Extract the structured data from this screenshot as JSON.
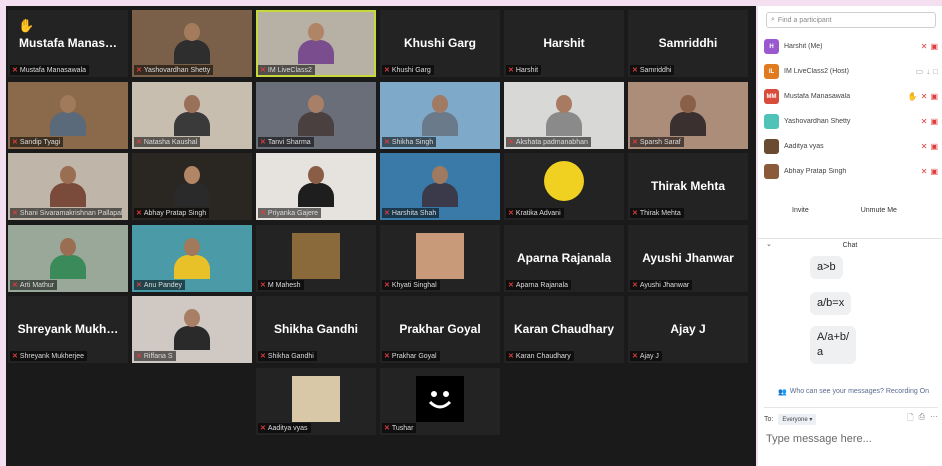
{
  "tiles": [
    {
      "name": "Mustafa  Manas…",
      "label": "Mustafa Manasawala",
      "video": false,
      "hand": true,
      "big": true
    },
    {
      "label": "Yashovardhan Shetty",
      "video": true,
      "bg": "#7a6048",
      "skin": "#a57b5e",
      "shirt": "#2e2e2e"
    },
    {
      "label": "IM LiveClass2",
      "video": true,
      "active": true,
      "bg": "#b7b0a4",
      "skin": "#b08466",
      "shirt": "#7a4d8e"
    },
    {
      "name": "Khushi Garg",
      "label": "Khushi Garg",
      "video": false,
      "big": true
    },
    {
      "name": "Harshit",
      "label": "Harshit",
      "video": false,
      "big": true
    },
    {
      "name": "Samriddhi",
      "label": "Samriddhi",
      "video": false,
      "big": true
    },
    {
      "label": "Sandip Tyagi",
      "video": true,
      "bg": "#8a6a4a",
      "skin": "#a07a5a",
      "shirt": "#5a6a7a"
    },
    {
      "label": "Natasha Kaushal",
      "video": true,
      "bg": "#c8beb0",
      "skin": "#9a7058",
      "shirt": "#3a3a3a"
    },
    {
      "label": "Tanvi Sharma",
      "video": true,
      "bg": "#6a6e78",
      "skin": "#a88068",
      "shirt": "#4a4040"
    },
    {
      "label": "Shikha Singh",
      "video": true,
      "bg": "#7ea9c8",
      "skin": "#a07a62",
      "shirt": "#6a7a8a"
    },
    {
      "label": "Akshata padmanabhan",
      "video": true,
      "bg": "#d8d8d6",
      "skin": "#a87a62",
      "shirt": "#8a8a8a"
    },
    {
      "label": "Sparsh Saraf",
      "video": true,
      "bg": "#ab8d7a",
      "skin": "#8a6048",
      "shirt": "#3a3030"
    },
    {
      "label": "Shani Sivaramakrishnan Pallapalli",
      "video": true,
      "bg": "#bfb5a8",
      "skin": "#9a6e52",
      "shirt": "#7a4a3a"
    },
    {
      "label": "Abhay Pratap Singh",
      "video": true,
      "bg": "#2a2622",
      "skin": "#b08666",
      "shirt": "#2a2a2a"
    },
    {
      "label": "Priyanka Gajere",
      "video": true,
      "bg": "#e6e3de",
      "skin": "#8a5e46",
      "shirt": "#1e1e1e"
    },
    {
      "label": "Harshita Shah",
      "video": true,
      "bg": "#3a7aa8",
      "skin": "#a07a60",
      "shirt": "#3a3a4a"
    },
    {
      "label": "Kratika Advani",
      "video": false,
      "emoji": "smiley"
    },
    {
      "name": "Thirak Mehta",
      "label": "Thirak Mehta",
      "video": false,
      "big": true
    },
    {
      "label": "Arti Mathur",
      "video": true,
      "bg": "#9aa89a",
      "skin": "#9a6e52",
      "shirt": "#3a8a5a"
    },
    {
      "label": "Anu Pandey",
      "video": true,
      "bg": "#4a9aa8",
      "skin": "#a07a5a",
      "shirt": "#e8c028"
    },
    {
      "label": "M Mahesh",
      "video": false,
      "inset": "#8a6a3a"
    },
    {
      "label": "Khyati Singhal",
      "video": false,
      "inset": "#c89a7a"
    },
    {
      "name": "Aparna Rajanala",
      "label": "Aparna Rajanala",
      "video": false,
      "big": true
    },
    {
      "name": "Ayushi Jhanwar",
      "label": "Ayushi Jhanwar",
      "video": false,
      "big": true
    },
    {
      "name": "Shreyank  Mukh…",
      "label": "Shreyank Mukherjee",
      "video": false,
      "big": true
    },
    {
      "label": "Riffana S",
      "video": true,
      "bg": "#d0c8c2",
      "skin": "#a87e66",
      "shirt": "#2a2a2a"
    },
    {
      "name": "Shikha Gandhi",
      "label": "Shikha Gandhi",
      "video": false,
      "big": true
    },
    {
      "name": "Prakhar Goyal",
      "label": "Prakhar Goyal",
      "video": false,
      "big": true
    },
    {
      "name": "Karan Chaudhary",
      "label": "Karan Chaudhary",
      "video": false,
      "big": true
    },
    {
      "name": "Ajay J",
      "label": "Ajay J",
      "video": false,
      "big": true
    },
    {
      "label": "Aaditya vyas",
      "video": false,
      "inset": "#d8c8a8"
    },
    {
      "label": "Tushar",
      "video": false,
      "emoji": "dark"
    }
  ],
  "sidebar": {
    "search_placeholder": "Find a participant",
    "participants": [
      {
        "initials": "H",
        "name": "Harshit (Me)",
        "color": "#9b59d0"
      },
      {
        "initials": "IL",
        "name": "IM LiveClass2 (Host)",
        "color": "#e07b20"
      },
      {
        "initials": "MM",
        "name": "Mustafa Manasawala",
        "color": "#d94b3a"
      },
      {
        "initials": "",
        "name": "Yashovardhan Shetty",
        "color": "#4fc3b8"
      },
      {
        "initials": "",
        "name": "Aaditya vyas",
        "color": "#6a4a30"
      },
      {
        "initials": "",
        "name": "Abhay Pratap Singh",
        "color": "#8a5a3a"
      }
    ],
    "invite": "Invite",
    "unmute_me": "Unmute Me",
    "chat_title": "Chat",
    "messages": [
      "a>b",
      "a/b=x",
      "A/a+b/\na"
    ],
    "who_can_see": "Who can see your messages? Recording On",
    "to_label": "To:",
    "to_value": "Everyone",
    "input_placeholder": "Type message here..."
  }
}
